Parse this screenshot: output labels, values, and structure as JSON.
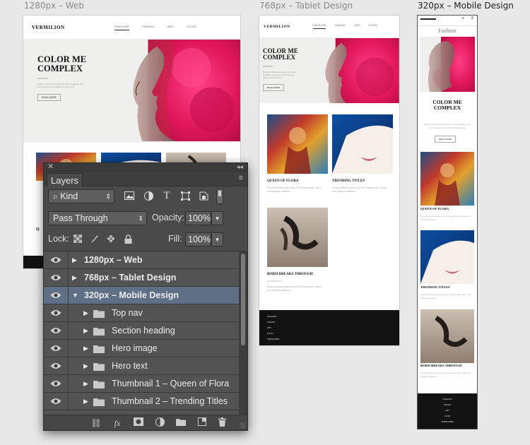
{
  "artboards": {
    "web": {
      "label": "1280px – Web",
      "logo": "VERMILION",
      "menu": [
        "FASHION",
        "TRAVEL",
        "ART",
        "FOOD"
      ],
      "hero_title": [
        "COLOR ME",
        "COMPLEX"
      ],
      "hero_sub": "EMI BASE",
      "hero_copy": "Bold fun treatments stay out of the shadows, see your favorite trend without transformed.",
      "hero_button": "READ MORE",
      "thumb_caption": "Q"
    },
    "tablet": {
      "label": "768px – Tablet Design",
      "logo": "VERMILION",
      "menu": [
        "FASHION",
        "TRAVEL",
        "ART",
        "FOOD"
      ],
      "hero_title": [
        "COLOR ME",
        "COMPLEX"
      ],
      "hero_sub": "EMI BASE",
      "hero_copy": "Bold fun treatments stay out of the shadows, see your favorite trend without transformed.",
      "hero_button": "READ MORE",
      "cards": [
        {
          "title": "QUEEN OF FLORA",
          "text": "Et quidi alciant quanu ped mei dupeat nelo. Idium eus melique delectus."
        },
        {
          "title": "TRENDING TITLES",
          "text": "Et quidi alciant quanu ped mei dupeat nelo. Idium eus melique delectus."
        },
        {
          "title": "BORSI BREAKS THROUGH",
          "meta": "FLOSBE BOOK",
          "text": "Et quidi alciant quanu ped mei dupeat nelo. Idium eus melique delectus."
        }
      ],
      "footer": [
        "FASHION",
        "TRAVEL",
        "ART",
        "FOOD",
        "SUBSCRIBE"
      ]
    },
    "mobile": {
      "label": "320px – Mobile Design",
      "section_heading": "Fashion",
      "hero_title": [
        "COLOR ME",
        "COMPLEX"
      ],
      "hero_copy": "Bold fun treatments stay out of the shadows, see your favorite trend without transformed.",
      "hero_button": "READ MORE",
      "cards": [
        {
          "title": "QUEEN OF FLORA",
          "text": "Et quidi alciant quanu ped mei dupeat nelo. Idium eus melique delectus."
        },
        {
          "title": "TRENDING TITLES",
          "text": "Et quidi alciant quanu ped mei dupeat nelo. Idium eus melique delectus."
        },
        {
          "title": "BORSI BREAKS THROUGH",
          "text": "Et quidi alciant quanu ped mei dupeat nelo. Idium eus melique delectus."
        }
      ],
      "footer": [
        "FASHION",
        "TRAVEL",
        "ART",
        "FOOD",
        "SUBSCRIBE"
      ]
    }
  },
  "layers_panel": {
    "close_glyph": "✕",
    "collapse_glyph": "◂◂",
    "tab": "Layers",
    "menu_glyph": "≡",
    "filter_kind": "Kind",
    "blend_mode": "Pass Through",
    "opacity_label": "Opacity:",
    "opacity_value": "100%",
    "lock_label": "Lock:",
    "fill_label": "Fill:",
    "fill_value": "100%",
    "layers": [
      {
        "name": "1280px – Web",
        "expanded": false,
        "type": "artboard"
      },
      {
        "name": "768px – Tablet Design",
        "expanded": false,
        "type": "artboard"
      },
      {
        "name": "320px – Mobile Design",
        "expanded": true,
        "type": "artboard",
        "selected": true
      },
      {
        "name": "Top nav",
        "type": "group"
      },
      {
        "name": "Section heading",
        "type": "group"
      },
      {
        "name": "Hero image",
        "type": "group"
      },
      {
        "name": "Hero text",
        "type": "group"
      },
      {
        "name": "Thumbnail 1 – Queen of Flora",
        "type": "group"
      },
      {
        "name": "Thumbnail 2 – Trending Titles",
        "type": "group"
      }
    ],
    "colors": {
      "panel": "#4a4a4a",
      "selection": "#5f6f86",
      "artboard_pink": "#e0175a"
    }
  }
}
